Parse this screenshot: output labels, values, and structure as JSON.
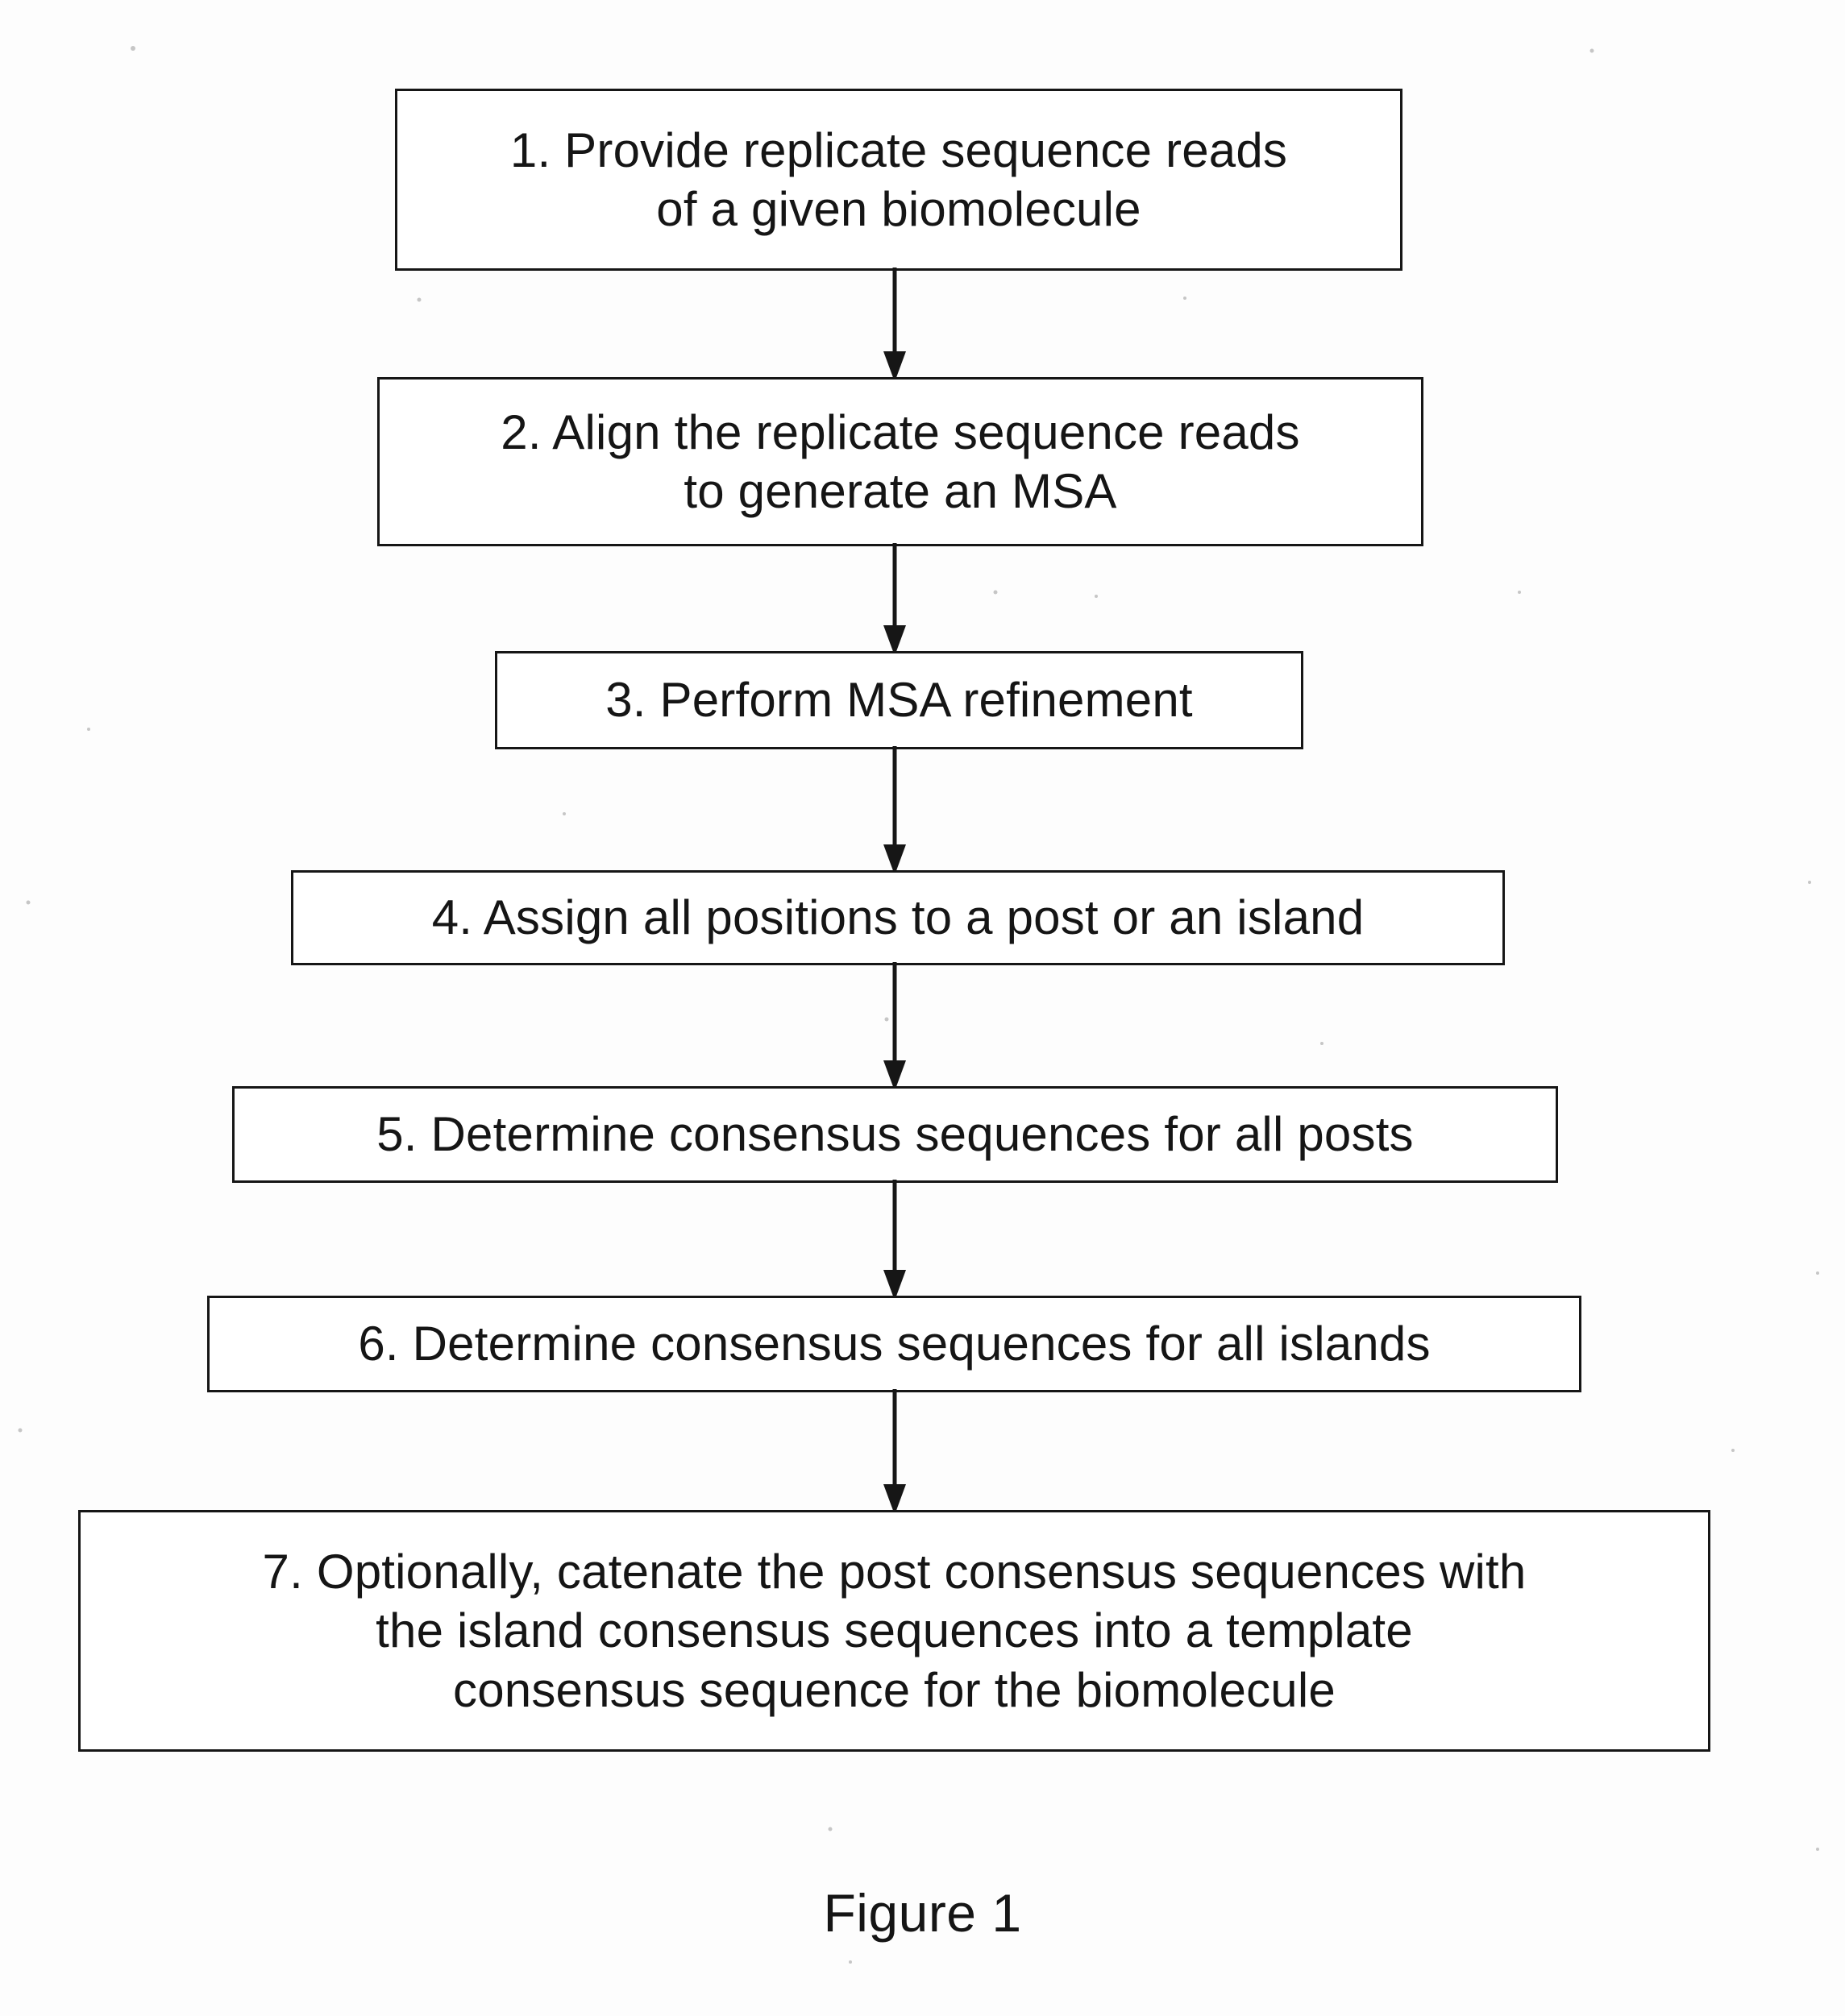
{
  "figure": {
    "caption": "Figure 1",
    "title": "Figure 1",
    "background_color": "#fdfdfd",
    "line_color": "#161616",
    "text_color": "#151515"
  },
  "flowchart": {
    "type": "flowchart",
    "orientation": "top-to-bottom",
    "connector_icon": "down-arrow-icon",
    "steps": [
      {
        "number": "1",
        "text": "1. Provide replicate sequence reads\nof a given biomolecule",
        "lines": [
          "1. Provide replicate sequence reads",
          "of a given biomolecule"
        ]
      },
      {
        "number": "2",
        "text": "2. Align the replicate sequence reads\nto generate an MSA",
        "lines": [
          "2. Align the replicate sequence reads",
          "to generate an MSA"
        ]
      },
      {
        "number": "3",
        "text": "3. Perform MSA refinement",
        "lines": [
          "3. Perform MSA refinement"
        ]
      },
      {
        "number": "4",
        "text": "4. Assign all positions to a post or an island",
        "lines": [
          "4. Assign all positions to a post or an island"
        ]
      },
      {
        "number": "5",
        "text": "5. Determine consensus sequences for all posts",
        "lines": [
          "5. Determine consensus sequences for all posts"
        ]
      },
      {
        "number": "6",
        "text": "6. Determine consensus sequences for all islands",
        "lines": [
          "6. Determine consensus sequences for all islands"
        ]
      },
      {
        "number": "7",
        "text": "7. Optionally, catenate the post consensus sequences with\nthe island consensus sequences into a template\nconsensus sequence for the biomolecule",
        "lines": [
          "7. Optionally, catenate the post consensus sequences with",
          "the island consensus sequences into a template",
          "consensus sequence for the biomolecule"
        ]
      }
    ]
  }
}
